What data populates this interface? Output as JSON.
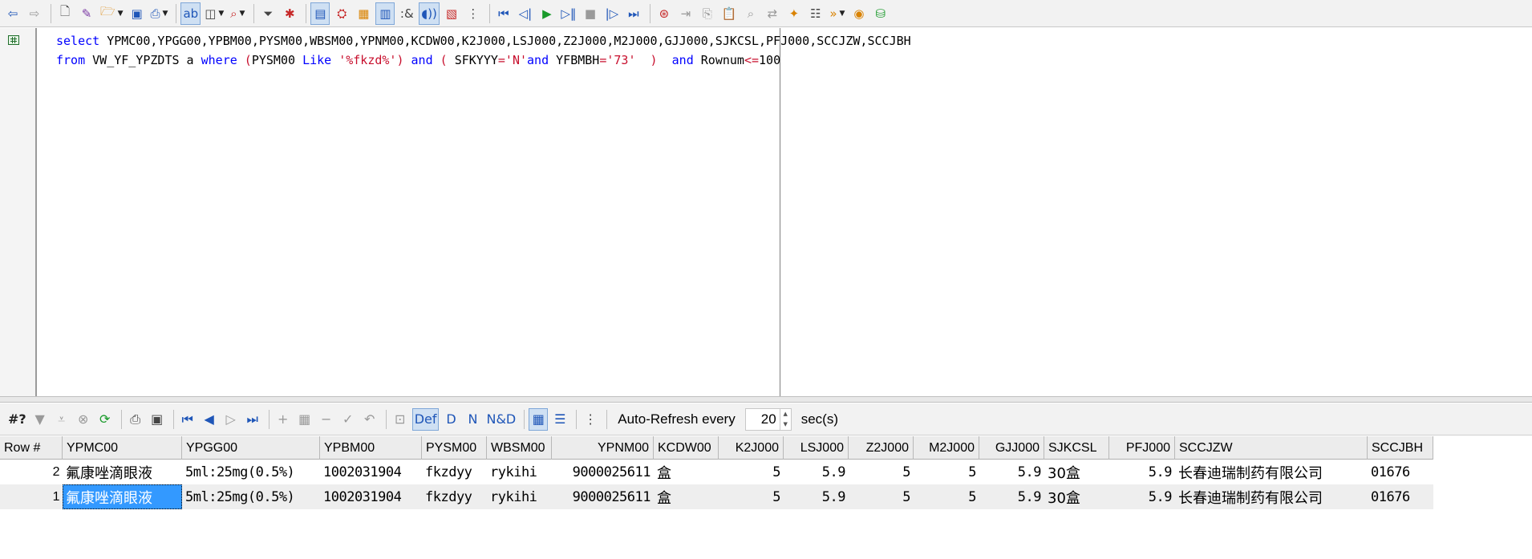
{
  "editor": {
    "line1": {
      "kw_select": "select",
      "columns": " YPMC00,YPGG00,YPBM00,PYSM00,WBSM00,YPNM00,KCDW00,K2J000,LSJ000,Z2J000,M2J000,GJJ000,SJKCSL,PFJ000,SCCJZW,SCCJBH"
    },
    "line2": {
      "kw_from": "from",
      "view": " VW_YF_YPZDTS a ",
      "kw_where": "where",
      "paren_open": " (",
      "col_pysm": "PYSM00 ",
      "kw_like": "Like",
      "str_fkzd": " '%fkzd%'",
      "paren_close": ")",
      "kw_and1": " and",
      "paren_open2": " ( ",
      "col_sfkyyy": "SFKYYY",
      "str_n": "='N'",
      "kw_and2": "and",
      "col_yfbmbh": " YFBMBH",
      "str_73": "='73'",
      "paren_close2": "  )  ",
      "kw_and3": "and",
      "col_rownum": " Rownum",
      "op_le": "<=",
      "num_100": "100"
    }
  },
  "grid_toolbar": {
    "auto_refresh_label": "Auto-Refresh every",
    "refresh_seconds": "20",
    "seconds_label": "sec(s)"
  },
  "grid": {
    "columns": [
      "Row #",
      "YPMC00",
      "YPGG00",
      "YPBM00",
      "PYSM00",
      "WBSM00",
      "YPNM00",
      "KCDW00",
      "K2J000",
      "LSJ000",
      "Z2J000",
      "M2J000",
      "GJJ000",
      "SJKCSL",
      "PFJ000",
      "SCCJZW",
      "SCCJBH"
    ],
    "rows": [
      [
        "2",
        "氟康唑滴眼液",
        "5ml:25mg(0.5%)",
        "1002031904",
        "fkzdyy",
        "rykihi",
        "9000025611",
        "盒",
        "5",
        "5.9",
        "5",
        "5",
        "5.9",
        "30盒",
        "5.9",
        "长春迪瑞制药有限公司",
        "01676"
      ],
      [
        "1",
        "氟康唑滴眼液",
        "5ml:25mg(0.5%)",
        "1002031904",
        "fkzdyy",
        "rykihi",
        "9000025611",
        "盒",
        "5",
        "5.9",
        "5",
        "5",
        "5.9",
        "30盒",
        "5.9",
        "长春迪瑞制药有限公司",
        "01676"
      ]
    ]
  },
  "colors": {
    "keyword": "#0000ff",
    "string": "#c8102e",
    "selection": "#3399ff",
    "alt_row": "#eeeeee"
  }
}
